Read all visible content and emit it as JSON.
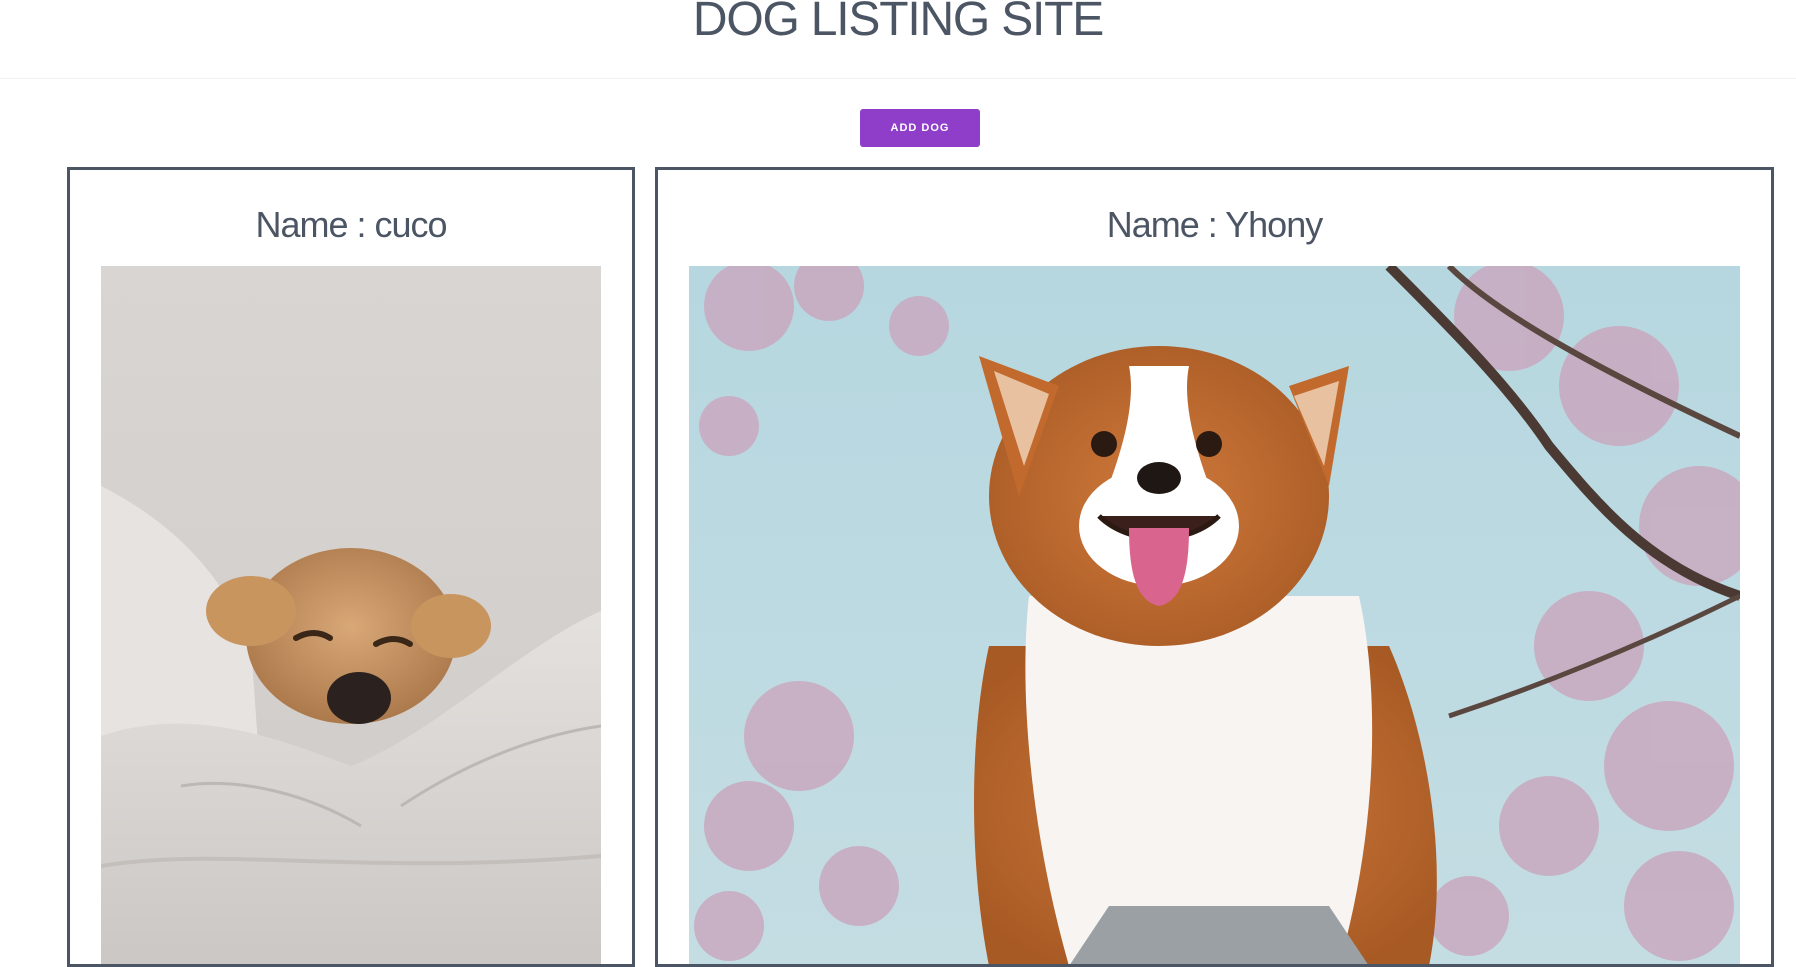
{
  "header": {
    "title": "DOG LISTING SITE"
  },
  "actions": {
    "add_dog_label": "ADD DOG"
  },
  "dogs": [
    {
      "label": "Name : cuco",
      "photo_subject": "cocker spaniel under white blanket"
    },
    {
      "label": "Name : Yhony",
      "photo_subject": "corgi in front of cherry blossoms"
    }
  ],
  "colors": {
    "accent": "#8e3ec8",
    "text": "#4b5563",
    "card_border": "#4b5563"
  }
}
